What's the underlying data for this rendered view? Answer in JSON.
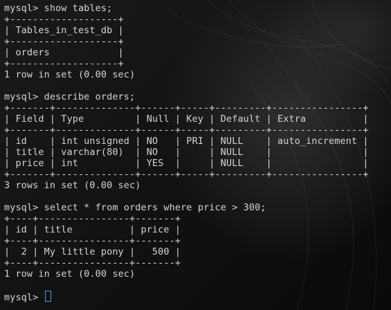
{
  "terminal": {
    "lines": [
      "mysql> show tables;",
      "+-------------------+",
      "| Tables_in_test_db |",
      "+-------------------+",
      "| orders            |",
      "+-------------------+",
      "1 row in set (0.00 sec)",
      "",
      "mysql> describe orders;",
      "+-------+--------------+------+-----+---------+----------------+",
      "| Field | Type         | Null | Key | Default | Extra          |",
      "+-------+--------------+------+-----+---------+----------------+",
      "| id    | int unsigned | NO   | PRI | NULL    | auto_increment |",
      "| title | varchar(80)  | NO   |     | NULL    |                |",
      "| price | int          | YES  |     | NULL    |                |",
      "+-------+--------------+------+-----+---------+----------------+",
      "3 rows in set (0.00 sec)",
      "",
      "mysql> select * from orders where price > 300;",
      "+----+----------------+-------+",
      "| id | title          | price |",
      "+----+----------------+-------+",
      "|  2 | My little pony |   500 |",
      "+----+----------------+-------+",
      "1 row in set (0.00 sec)",
      ""
    ],
    "prompt": "mysql> ",
    "colors": {
      "background": "#0c0c0c",
      "text": "#d6d6d6",
      "cursor": "#4aa3d6"
    }
  }
}
